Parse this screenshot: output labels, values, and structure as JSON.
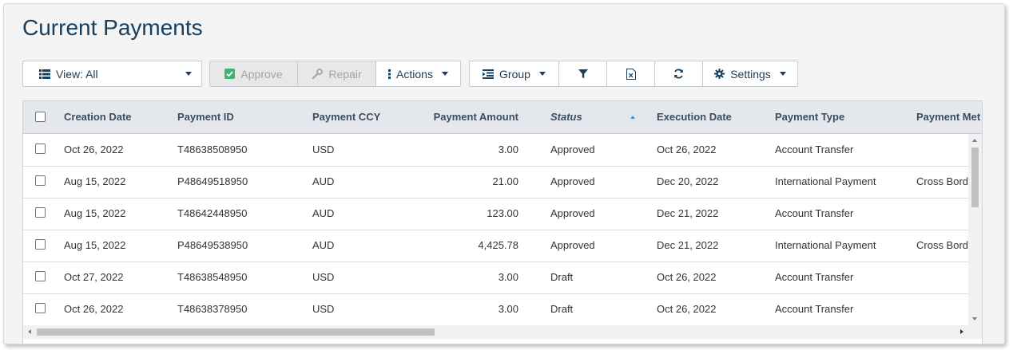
{
  "page": {
    "title": "Current Payments"
  },
  "toolbar": {
    "view_label": "View: All",
    "approve_label": "Approve",
    "repair_label": "Repair",
    "actions_label": "Actions",
    "group_label": "Group",
    "settings_label": "Settings",
    "icons": {
      "view": "list-icon",
      "approve": "check-icon",
      "repair": "wrench-icon",
      "actions": "vertical-dots-icon",
      "group": "indent-icon",
      "filter": "filter-icon",
      "export": "excel-icon",
      "refresh": "refresh-icon",
      "settings": "gear-icon"
    }
  },
  "table": {
    "columns": [
      "Creation Date",
      "Payment ID",
      "Payment CCY",
      "Payment Amount",
      "Status",
      "Execution Date",
      "Payment Type",
      "Payment Met"
    ],
    "sort": {
      "column": "Status",
      "direction": "ascending"
    },
    "rows": [
      [
        "Oct 26, 2022",
        "T48638508950",
        "USD",
        "3.00",
        "Approved",
        "Oct 26, 2022",
        "Account Transfer",
        ""
      ],
      [
        "Aug 15, 2022",
        "P48649518950",
        "AUD",
        "21.00",
        "Approved",
        "Dec 20, 2022",
        "International Payment",
        "Cross Borde"
      ],
      [
        "Aug 15, 2022",
        "T48642448950",
        "AUD",
        "123.00",
        "Approved",
        "Dec 21, 2022",
        "Account Transfer",
        ""
      ],
      [
        "Aug 15, 2022",
        "P48649538950",
        "AUD",
        "4,425.78",
        "Approved",
        "Dec 21, 2022",
        "International Payment",
        "Cross Borde"
      ],
      [
        "Oct 27, 2022",
        "T48638548950",
        "USD",
        "3.00",
        "Draft",
        "Oct 26, 2022",
        "Account Transfer",
        ""
      ],
      [
        "Oct 26, 2022",
        "T48638378950",
        "USD",
        "3.00",
        "Draft",
        "Oct 26, 2022",
        "Account Transfer",
        ""
      ]
    ]
  },
  "colors": {
    "title": "#17405e",
    "header_bg": "#e4e8ec",
    "approve_check": "#3cb371",
    "border": "#c7ccd1"
  }
}
